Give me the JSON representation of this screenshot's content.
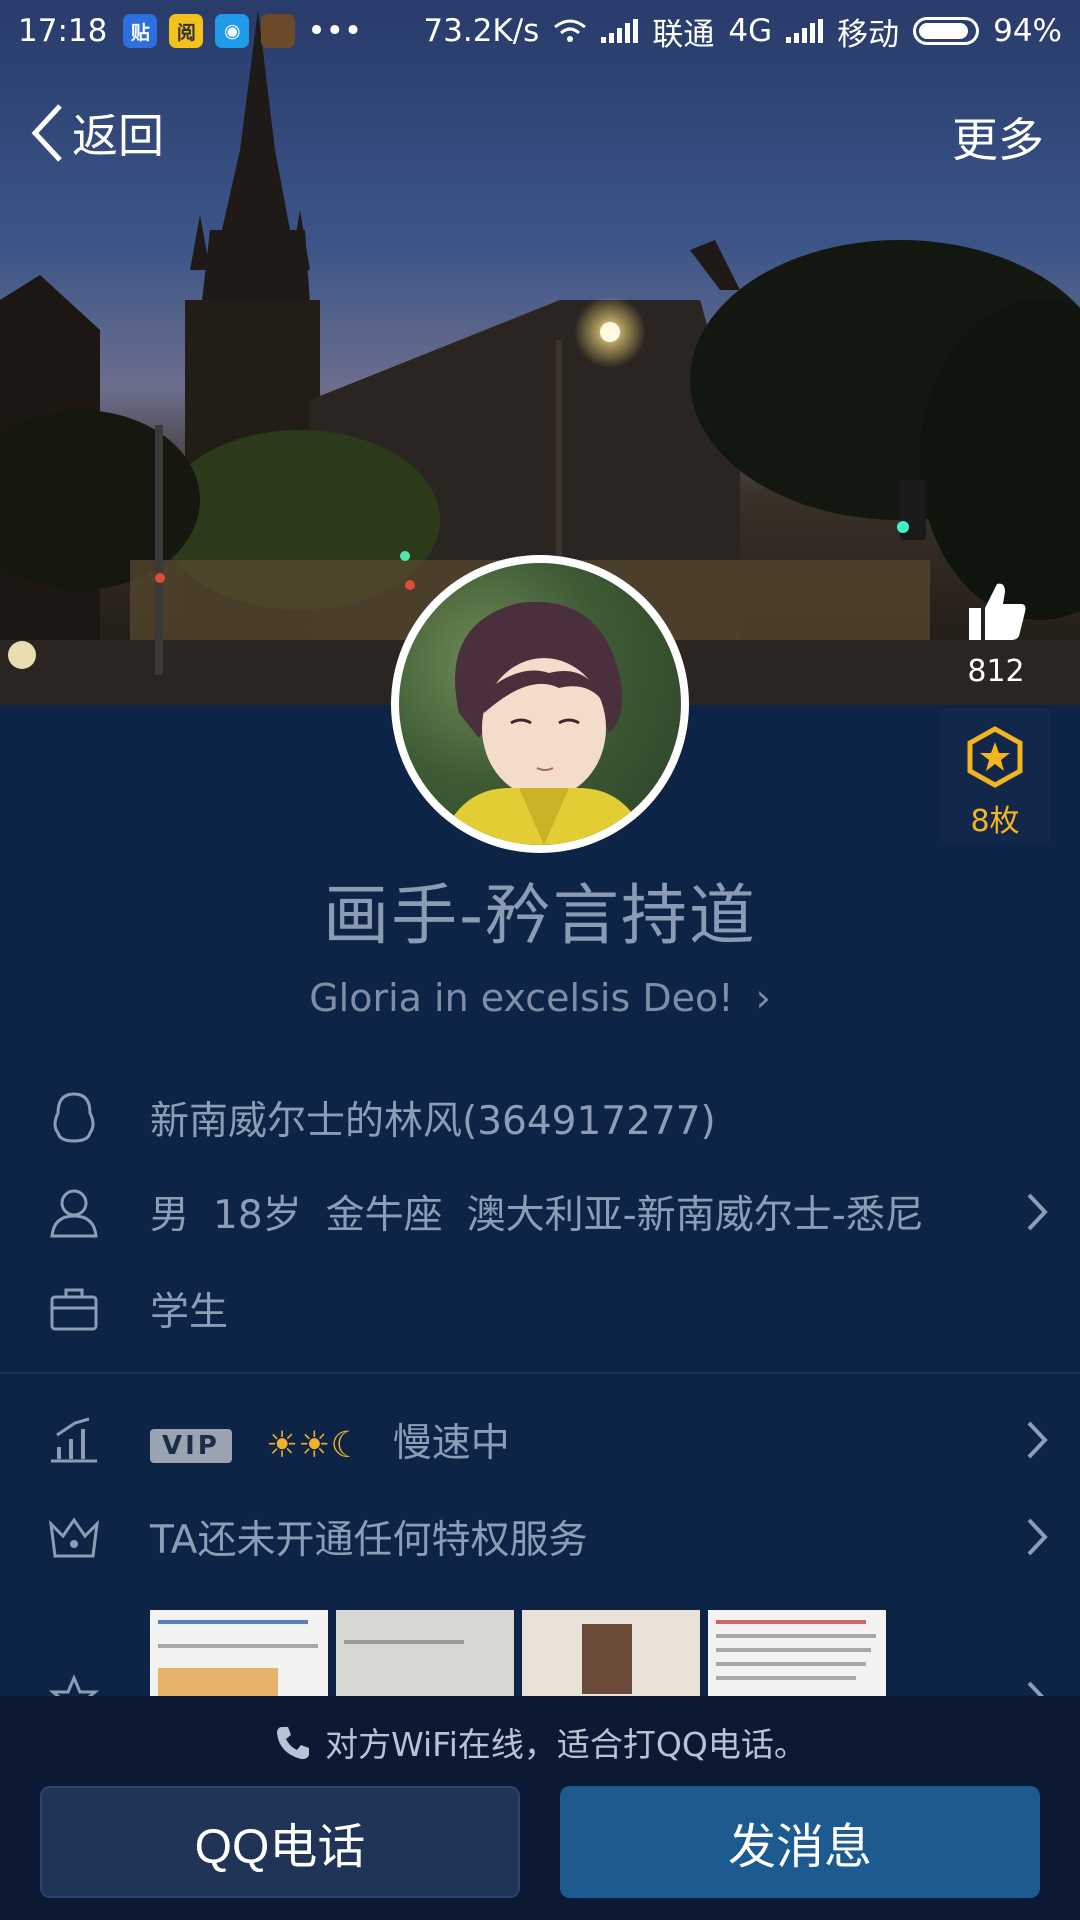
{
  "status_bar": {
    "time": "17:18",
    "net_speed": "73.2K/s",
    "carrier1_name": "联通",
    "carrier1_type": "4G",
    "carrier2_name": "移动",
    "battery": "94%",
    "more_dots": "•••",
    "app_icons": [
      {
        "name": "tieba-app-icon",
        "label": "贴",
        "bg": "#2e6fe0"
      },
      {
        "name": "news-app-icon",
        "label": "阅",
        "bg": "#f2c21a"
      },
      {
        "name": "browser-app-icon",
        "label": "◉",
        "bg": "#1f9bea"
      }
    ]
  },
  "nav": {
    "back_label": "返回",
    "more_label": "更多"
  },
  "like": {
    "count": "812"
  },
  "medal": {
    "count": "8枚"
  },
  "profile": {
    "nickname": "画手-矜言持道",
    "signature": "Gloria in excelsis Deo!",
    "signature_chevron": "›"
  },
  "info_rows": {
    "account": "新南威尔士的林风(364917277)",
    "gender": "男",
    "age": "18岁",
    "zodiac": "金牛座",
    "location": "澳大利亚-新南威尔士-悉尼",
    "occupation": "学生"
  },
  "level_row": {
    "vip_label": "VIP",
    "speed_text": "慢速中"
  },
  "privilege_row": {
    "text": "TA还未开通任何特权服务"
  },
  "bottom_bar": {
    "wifi_tip": "对方WiFi在线，适合打QQ电话。",
    "call_button": "QQ电话",
    "message_button": "发消息"
  },
  "colors": {
    "background": "#0d2446",
    "accent_button": "#1d5a8f",
    "medal_gold": "#f2b51e"
  }
}
